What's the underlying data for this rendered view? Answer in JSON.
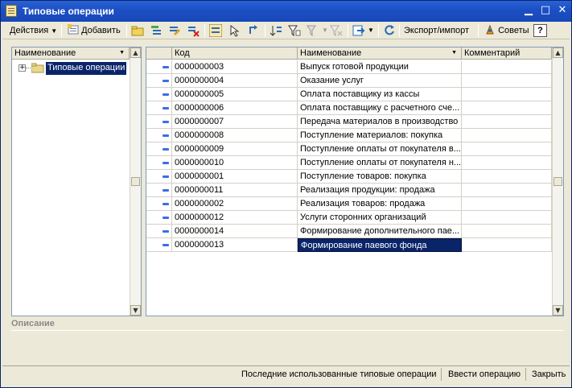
{
  "window": {
    "title": "Типовые операции"
  },
  "toolbar": {
    "actions_label": "Действия",
    "add_label": "Добавить",
    "export_import_label": "Экспорт/импорт",
    "tips_label": "Советы",
    "help_label": "?"
  },
  "tree": {
    "header": "Наименование",
    "root_label": "Типовые операции"
  },
  "table": {
    "columns": {
      "code": "Код",
      "name": "Наименование",
      "comment": "Комментарий"
    },
    "rows": [
      {
        "code": "0000000003",
        "name": "Выпуск готовой продукции",
        "comment": ""
      },
      {
        "code": "0000000004",
        "name": "Оказание услуг",
        "comment": ""
      },
      {
        "code": "0000000005",
        "name": "Оплата поставщику из кассы",
        "comment": ""
      },
      {
        "code": "0000000006",
        "name": "Оплата поставщику с расчетного сче...",
        "comment": ""
      },
      {
        "code": "0000000007",
        "name": "Передача материалов в производство",
        "comment": ""
      },
      {
        "code": "0000000008",
        "name": "Поступление материалов: покупка",
        "comment": ""
      },
      {
        "code": "0000000009",
        "name": "Поступление оплаты от покупателя в...",
        "comment": ""
      },
      {
        "code": "0000000010",
        "name": "Поступление оплаты от покупателя н...",
        "comment": ""
      },
      {
        "code": "0000000001",
        "name": "Поступление товаров: покупка",
        "comment": ""
      },
      {
        "code": "0000000011",
        "name": "Реализация продукции: продажа",
        "comment": ""
      },
      {
        "code": "0000000002",
        "name": "Реализация товаров: продажа",
        "comment": ""
      },
      {
        "code": "0000000012",
        "name": "Услуги сторонних организаций",
        "comment": ""
      },
      {
        "code": "0000000014",
        "name": "Формирование дополнительного пае...",
        "comment": ""
      },
      {
        "code": "0000000013",
        "name": "Формирование паевого фонда",
        "comment": ""
      }
    ],
    "selected_row": 13
  },
  "description": {
    "label": "Описание"
  },
  "statusbar": {
    "recent_label": "Последние использованные типовые операции",
    "enter_label": "Ввести операцию",
    "close_label": "Закрыть"
  },
  "colors": {
    "title_bar": "#1c4fc4",
    "selection": "#0a246a",
    "row_marker": "#3a6ee8"
  }
}
